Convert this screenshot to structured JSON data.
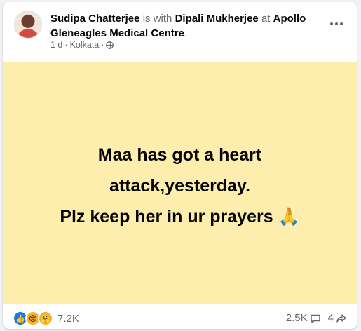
{
  "post": {
    "author": "Sudipa Chatterjee",
    "with_text": "is with",
    "tagged": "Dipali Mukherjee",
    "at_text": "at",
    "location": "Apollo Gleneagles Medical Centre",
    "period": ".",
    "time": "1 d",
    "separator1": "·",
    "city": "Kolkata",
    "separator2": "·",
    "privacy_icon": "globe-icon",
    "more_icon": "more-options-icon",
    "background_color": "#fdeeae",
    "content": {
      "line1": "Maa has got a heart",
      "line2": "attack,yesterday.",
      "line3": "Plz keep her in ur prayers 🙏"
    }
  },
  "footer": {
    "reactions": [
      "like-icon",
      "sad-icon",
      "care-icon"
    ],
    "reaction_count": "7.2K",
    "comment_count": "2.5K",
    "share_count": "4",
    "comment_icon": "comment-icon",
    "share_icon": "share-icon"
  },
  "colors": {
    "text": "#050505",
    "secondary": "#65676b",
    "like": "#1877f2"
  }
}
